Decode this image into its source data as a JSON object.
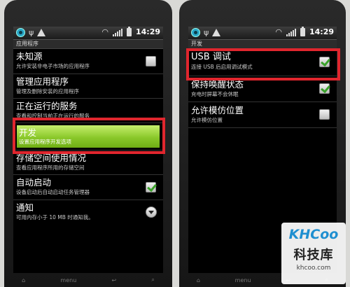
{
  "left": {
    "status": {
      "time": "14:29"
    },
    "title": "应用程序",
    "items": [
      {
        "title": "未知源",
        "subtitle": "允许安装非电子市场的应用程序",
        "control": "checkbox",
        "checked": false
      },
      {
        "title": "管理应用程序",
        "subtitle": "管理及删除安装的应用程序"
      },
      {
        "title": "正在运行的服务",
        "subtitle": "查看和控制当前正在运行的服务"
      },
      {
        "title": "开发",
        "subtitle": "设置应用程序开发选项",
        "highlighted": true
      },
      {
        "title": "存储空间使用情况",
        "subtitle": "查看应用程序所用的存储空间"
      },
      {
        "title": "自动启动",
        "subtitle": "设备启动后自动启动任务管理器",
        "control": "checkbox",
        "checked": true
      },
      {
        "title": "通知",
        "subtitle": "可用内存小于 10 MB 时通知我。",
        "control": "dropdown"
      }
    ],
    "softkeys": [
      "⌂",
      "menu",
      "↩",
      "⌕"
    ]
  },
  "right": {
    "status": {
      "time": "14:29"
    },
    "title": "开发",
    "items": [
      {
        "title": "USB 调试",
        "subtitle": "连接 USB 后启用调试模式",
        "control": "checkbox",
        "checked": true
      },
      {
        "title": "保持唤醒状态",
        "subtitle": "充电时屏幕不会休眠",
        "control": "checkbox",
        "checked": true
      },
      {
        "title": "允许模仿位置",
        "subtitle": "允许模仿位置",
        "control": "checkbox",
        "checked": false
      }
    ],
    "softkeys": [
      "⌂",
      "menu",
      "↩",
      "⌕"
    ]
  },
  "watermark": {
    "logo": "KHCoo",
    "name": "科技库",
    "url": "khcoo.com"
  },
  "colors": {
    "highlight": "#8ac82a",
    "annotation_box": "#e0262e",
    "check": "#3aa22a"
  },
  "icons": {
    "status_left": [
      "sync-icon",
      "usb-icon",
      "warning-icon"
    ],
    "status_right": [
      "wifi-icon",
      "signal-icon",
      "battery-icon"
    ]
  }
}
